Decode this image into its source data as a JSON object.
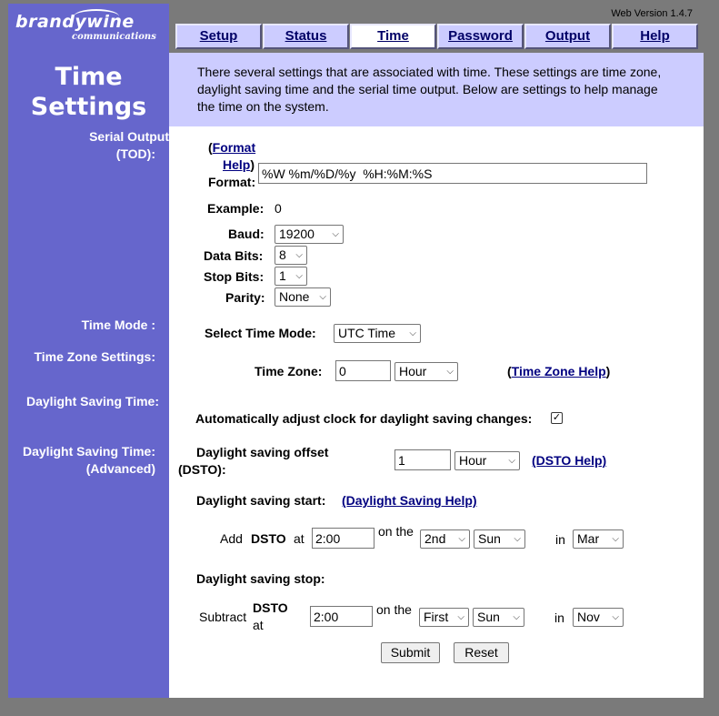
{
  "header": {
    "logo_main": "brandywine",
    "logo_sub": "communications",
    "version": "Web Version 1.4.7",
    "tabs": [
      "Setup",
      "Status",
      "Time",
      "Password",
      "Output",
      "Help"
    ],
    "active_tab": "Time"
  },
  "page": {
    "title_line1": "Time",
    "title_line2": "Settings",
    "intro": "There several settings that are associated with time. These settings are time zone, daylight saving time and the serial time output. Below are settings to help manage the time on the system."
  },
  "sections": {
    "serial_output_l1": "Serial Output",
    "serial_output_l2": "(TOD):",
    "time_mode": "Time Mode :",
    "time_zone_settings": "Time Zone Settings:",
    "dst": "Daylight Saving Time:",
    "dst_adv_l1": "Daylight Saving Time:",
    "dst_adv_l2": "(Advanced)"
  },
  "serial": {
    "format_help_open": "(",
    "format_help_link1": "Format",
    "format_help_link2": "Help",
    "format_help_close": ")",
    "format_label": "Format:",
    "format_value": "%W %m/%D/%y  %H:%M:%S",
    "example_label": "Example:",
    "example_value": "0",
    "baud_label": "Baud:",
    "baud_value": "19200",
    "data_bits_label": "Data Bits:",
    "data_bits_value": "8",
    "stop_bits_label": "Stop Bits:",
    "stop_bits_value": "1",
    "parity_label": "Parity:",
    "parity_value": "None"
  },
  "time_mode": {
    "label": "Select Time Mode:",
    "value": "UTC Time"
  },
  "time_zone": {
    "label": "Time Zone:",
    "value": "0",
    "unit": "Hour",
    "help_open": "(",
    "help_link": "Time Zone Help",
    "help_close": ")"
  },
  "dst": {
    "auto_label": "Automatically adjust clock for daylight saving changes:",
    "auto_checked": true,
    "offset_label_l1": "Daylight saving offset",
    "offset_label_l2": "(DSTO):",
    "offset_value": "1",
    "offset_unit": "Hour",
    "dsto_help": "(DSTO Help)",
    "start_label": "Daylight saving start:",
    "start_help": "(Daylight Saving Help)",
    "start_add": "Add",
    "start_dsto": "DSTO",
    "start_at": "at",
    "start_time": "2:00",
    "start_on_the": "on the",
    "start_week": "2nd",
    "start_day": "Sun",
    "start_in": "in",
    "start_month": "Mar",
    "stop_label": "Daylight saving stop:",
    "stop_subtract": "Subtract",
    "stop_dsto": "DSTO",
    "stop_at": "at",
    "stop_time": "2:00",
    "stop_on_the": "on the",
    "stop_week": "First",
    "stop_day": "Sun",
    "stop_in": "in",
    "stop_month": "Nov"
  },
  "actions": {
    "submit": "Submit",
    "reset": "Reset"
  }
}
